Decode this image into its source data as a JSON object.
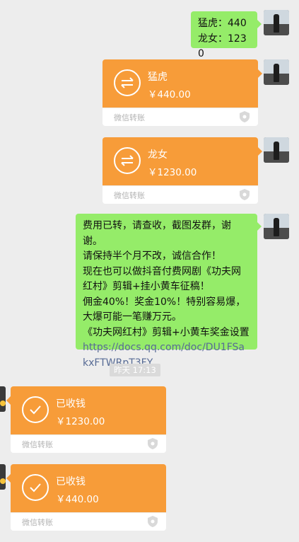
{
  "messages": {
    "m1": {
      "lines": [
        "猛虎：440",
        "龙女：1230"
      ]
    },
    "t1": {
      "title": "猛虎",
      "amount": "￥440.00",
      "label": "微信转账"
    },
    "t2": {
      "title": "龙女",
      "amount": "￥1230.00",
      "label": "微信转账"
    },
    "m2": {
      "lines": [
        "费用已转，请查收，截图发群，谢谢。",
        "请保持半个月不改，诚信合作！",
        "现在也可以做抖音付费网剧《功夫网红村》剪辑+挂小黄车征稿！",
        "佣金40%！奖金10%！特别容易爆，大爆可能一笔赚万元。",
        "《功夫网红村》剪辑+小黄车奖金设置"
      ],
      "link": "https://docs.qq.com/doc/DU1FSakxFTWRpT3FY"
    },
    "timestamp": "昨天 17:13",
    "r1": {
      "title": "已收钱",
      "amount": "￥1230.00",
      "label": "微信转账"
    },
    "r2": {
      "title": "已收钱",
      "amount": "￥440.00",
      "label": "微信转账"
    }
  },
  "colors": {
    "chat_bg": "#ededed",
    "sent_bubble": "#95ec69",
    "transfer_orange": "#f79c39",
    "link": "#576b95"
  }
}
